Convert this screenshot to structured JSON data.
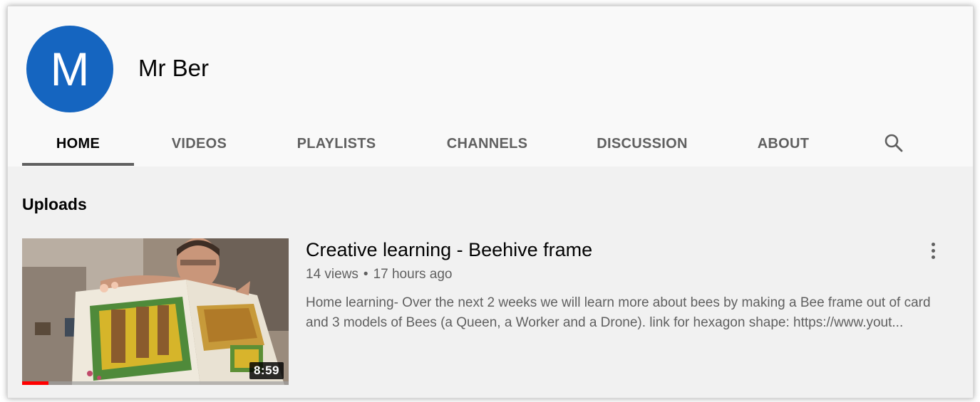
{
  "channel": {
    "avatar_letter": "M",
    "avatar_color": "#1565c0",
    "name": "Mr Ber"
  },
  "tabs": [
    {
      "label": "HOME",
      "active": true
    },
    {
      "label": "VIDEOS",
      "active": false
    },
    {
      "label": "PLAYLISTS",
      "active": false
    },
    {
      "label": "CHANNELS",
      "active": false
    },
    {
      "label": "DISCUSSION",
      "active": false
    },
    {
      "label": "ABOUT",
      "active": false
    }
  ],
  "search_icon": "search-icon",
  "uploads": {
    "section_title": "Uploads",
    "videos": [
      {
        "title": "Creative learning - Beehive frame",
        "views": "14 views",
        "separator": "•",
        "age": "17 hours ago",
        "description": "Home learning- Over the next 2 weeks we will learn more about bees by making a Bee frame out of card and 3 models of Bees (a Queen, a Worker and a Drone). link for hexagon shape: https://www.yout...",
        "duration": "8:59",
        "watched_fraction": 0.1,
        "menu_icon": "more-vert-icon"
      }
    ]
  },
  "colors": {
    "accent_progress": "#ff0000",
    "tab_underline": "#606060",
    "content_bg": "#f1f1f1"
  }
}
